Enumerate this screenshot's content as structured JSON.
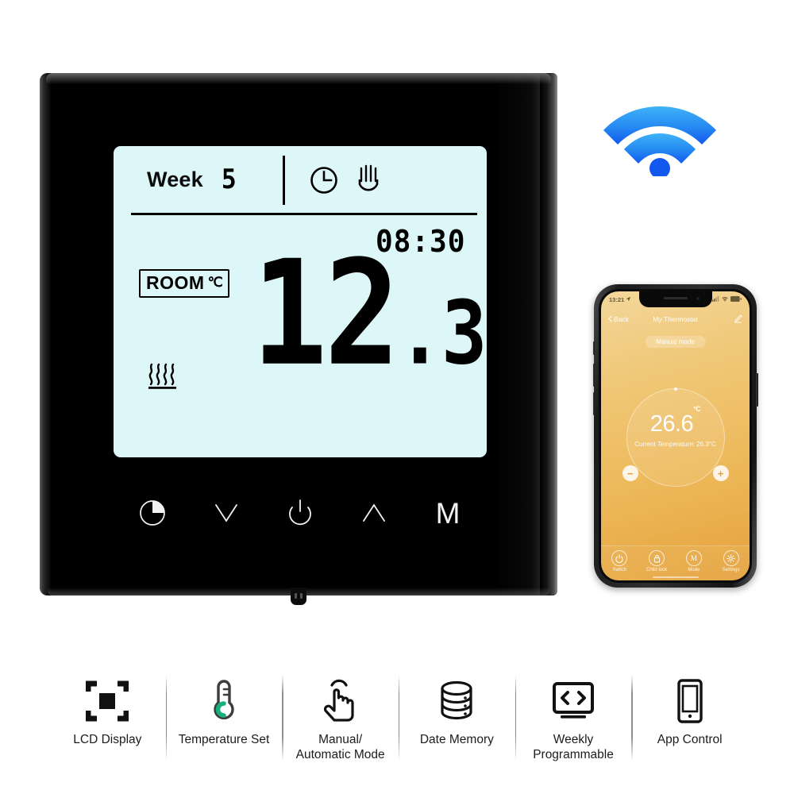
{
  "device": {
    "name": "wifi-smart-thermostat",
    "lcd": {
      "week_label": "Week",
      "week_value": "5",
      "clock_icon": "clock-icon",
      "hand_icon": "hand-manual-icon",
      "time": "08:30",
      "room_label": "ROOM",
      "room_unit": "℃",
      "heat_icon": "heating-waves-icon",
      "temperature_int": "12",
      "temperature_dec": ".3",
      "background_color": "#ddf7f9"
    },
    "buttons": [
      {
        "name": "clock-button",
        "glyph": "clock-pie-icon"
      },
      {
        "name": "down-button",
        "glyph": "chevron-down-icon"
      },
      {
        "name": "power-button",
        "glyph": "power-icon"
      },
      {
        "name": "up-button",
        "glyph": "chevron-up-icon"
      },
      {
        "name": "mode-button",
        "label": "M"
      }
    ],
    "frame_color": "#000000"
  },
  "wifi": {
    "icon": "wifi-icon",
    "color_top": "#3aa9f5",
    "color_bottom": "#1565f0"
  },
  "phone": {
    "status_bar": {
      "time": "13:21",
      "location_icon": "location-arrow-icon",
      "signal_icon": "cellular-signal-icon",
      "wifi_icon": "wifi-status-icon",
      "battery_icon": "battery-icon"
    },
    "nav": {
      "back_label": "Back",
      "back_icon": "chevron-left-icon",
      "title": "My Thermostat",
      "edit_icon": "pencil-edit-icon"
    },
    "mode_pill": "Manual mode",
    "dial": {
      "set_temperature": "26.6",
      "unit": "°C",
      "current_label": "Current Temperature: 26.3°C",
      "minus_label": "−",
      "plus_label": "+"
    },
    "tabs": [
      {
        "name": "tab-switch",
        "label": "Switch",
        "icon": "power-icon"
      },
      {
        "name": "tab-child-lock",
        "label": "Child lock",
        "icon": "lock-icon"
      },
      {
        "name": "tab-mode",
        "label": "Mode",
        "icon": "mode-m-icon"
      },
      {
        "name": "tab-settings",
        "label": "Settings",
        "icon": "gear-icon"
      }
    ],
    "screen_gradient_top": "#f3d79a",
    "screen_gradient_bottom": "#e4a23e"
  },
  "features": [
    {
      "name": "feature-lcd-display",
      "icon": "lcd-display-icon",
      "label": "LCD Display"
    },
    {
      "name": "feature-temperature-set",
      "icon": "thermometer-icon",
      "label": "Temperature Set"
    },
    {
      "name": "feature-manual-auto-mode",
      "icon": "hand-tap-icon",
      "label": "Manual/\nAutomatic Mode"
    },
    {
      "name": "feature-date-memory",
      "icon": "database-icon",
      "label": "Date Memory"
    },
    {
      "name": "feature-weekly-programmable",
      "icon": "code-monitor-icon",
      "label": "Weekly\nProgrammable"
    },
    {
      "name": "feature-app-control",
      "icon": "smartphone-icon",
      "label": "App Control"
    }
  ]
}
